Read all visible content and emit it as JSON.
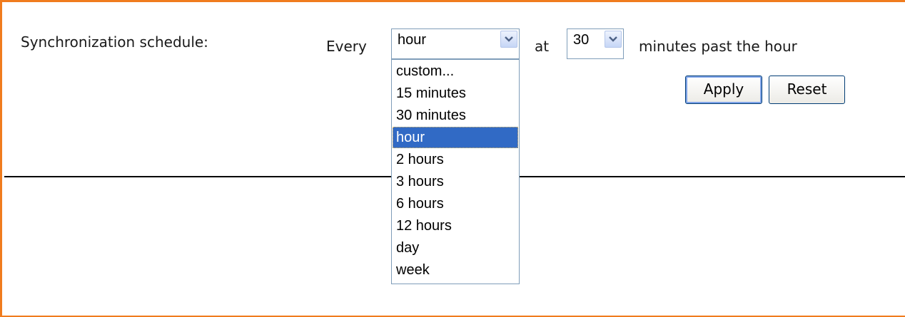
{
  "schedule": {
    "label": "Synchronization schedule:",
    "every_label": "Every",
    "interval_value": "hour",
    "at_label": "at",
    "minutes_value": "30",
    "suffix_label": "minutes past the hour"
  },
  "buttons": {
    "apply": "Apply",
    "reset": "Reset"
  },
  "interval_options": [
    "custom...",
    "15 minutes",
    "30 minutes",
    "hour",
    "2 hours",
    "3 hours",
    "6 hours",
    "12 hours",
    "day",
    "week"
  ],
  "selected_option": "hour",
  "colors": {
    "frame": "#f07c1e",
    "selection": "#316ac5",
    "control_border": "#7f9db9"
  }
}
